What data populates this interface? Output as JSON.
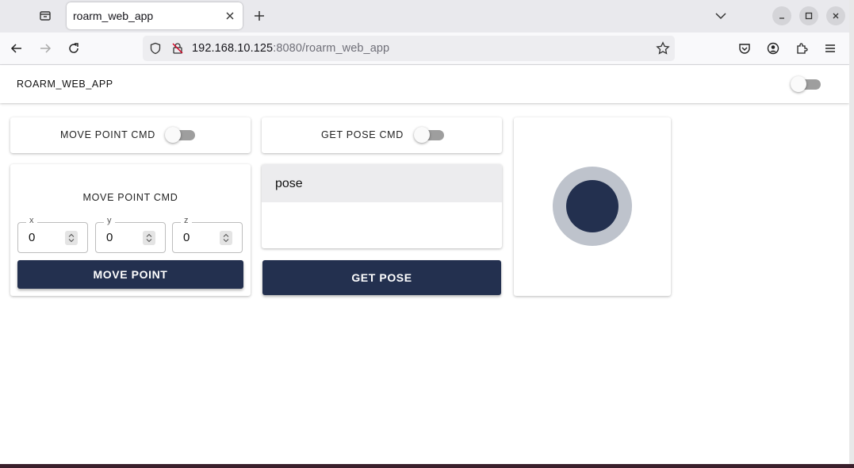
{
  "browser": {
    "tab": {
      "title": "roarm_web_app"
    },
    "url": {
      "host": "192.168.10.125",
      "rest": ":8080/roarm_web_app"
    }
  },
  "app": {
    "title": "ROARM_WEB_APP",
    "move_switch_label": "MOVE POINT CMD",
    "pose_switch_label": "GET POSE CMD",
    "move_panel": {
      "heading": "MOVE POINT CMD",
      "fields": [
        {
          "label": "x",
          "value": "0"
        },
        {
          "label": "y",
          "value": "0"
        },
        {
          "label": "z",
          "value": "0"
        }
      ],
      "button_label": "MOVE POINT"
    },
    "pose_panel": {
      "heading": "pose",
      "button_label": "GET POSE"
    },
    "joystick": {
      "outer_color": "#bec3cc",
      "inner_color": "#23304f"
    }
  }
}
